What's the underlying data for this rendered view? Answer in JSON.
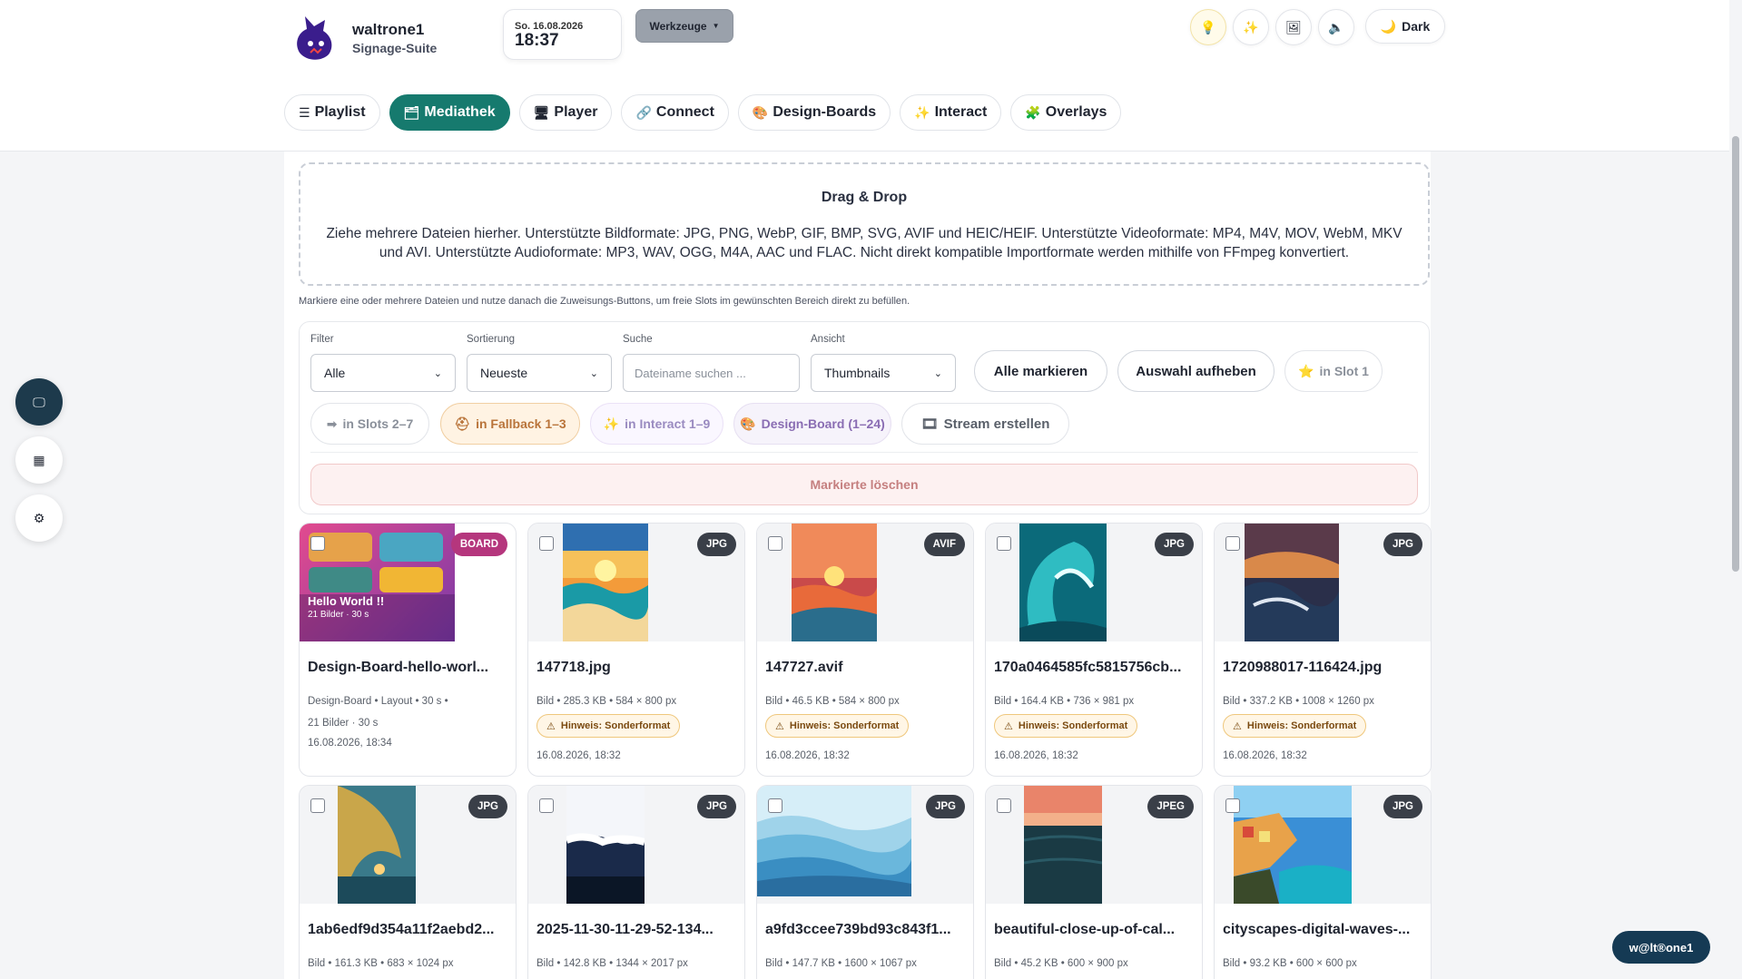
{
  "brand": {
    "name": "waltrone1",
    "subtitle": "Signage-Suite"
  },
  "clock": {
    "date": "So. 16.08.2026",
    "time": "18:37"
  },
  "toolbar": {
    "tools_label": "Werkzeuge",
    "dark_label": "Dark"
  },
  "tabs": [
    {
      "label": "Playlist",
      "icon": "☰"
    },
    {
      "label": "Mediathek",
      "icon": "🗂"
    },
    {
      "label": "Player",
      "icon": "🖥"
    },
    {
      "label": "Connect",
      "icon": "🔗"
    },
    {
      "label": "Design-Boards",
      "icon": "🎨"
    },
    {
      "label": "Interact",
      "icon": "✨"
    },
    {
      "label": "Overlays",
      "icon": "🧩"
    }
  ],
  "dropzone": {
    "title": "Drag & Drop",
    "text": "Ziehe mehrere Dateien hierher. Unterstützte Bildformate: JPG, PNG, WebP, GIF, BMP, SVG, AVIF und HEIC/HEIF. Unterstützte Videoformate: MP4, M4V, MOV, WebM, MKV und AVI. Unterstützte Audioformate: MP3, WAV, OGG, M4A, AAC und FLAC. Nicht direkt kompatible Importformate werden mithilfe von FFmpeg konvertiert."
  },
  "hint": "Markiere eine oder mehrere Dateien und nutze danach die Zuweisungs-Buttons, um freie Slots im gewünschten Bereich direkt zu befüllen.",
  "controls": {
    "filter_label": "Filter",
    "filter_value": "Alle",
    "sort_label": "Sortierung",
    "sort_value": "Neueste",
    "search_label": "Suche",
    "search_placeholder": "Dateiname suchen ...",
    "view_label": "Ansicht",
    "view_value": "Thumbnails",
    "select_all": "Alle markieren",
    "deselect": "Auswahl aufheben",
    "slot1": "in Slot 1",
    "slots27": "in Slots 2–7",
    "fallback": "in Fallback 1–3",
    "interact": "in Interact 1–9",
    "design": "Design-Board (1–24)",
    "stream": "Stream erstellen",
    "delete": "Markierte löschen"
  },
  "cards": [
    {
      "name": "Design-Board-hello-worl...",
      "badge": "BOARD",
      "meta1": "Design-Board  •  Layout  •  30 s  •",
      "meta2": "21 Bilder · 30 s",
      "date": "16.08.2026, 18:34",
      "board_title": "Hello World !!",
      "board_sub": "21 Bilder · 30 s"
    },
    {
      "name": "147718.jpg",
      "badge": "JPG",
      "meta1": "Bild  •  285.3 KB  •  584 × 800 px",
      "warn": "Hinweis: Sonderformat",
      "date": "16.08.2026, 18:32"
    },
    {
      "name": "147727.avif",
      "badge": "AVIF",
      "meta1": "Bild  •  46.5 KB  •  584 × 800 px",
      "warn": "Hinweis: Sonderformat",
      "date": "16.08.2026, 18:32"
    },
    {
      "name": "170a0464585fc5815756cb...",
      "badge": "JPG",
      "meta1": "Bild  •  164.4 KB  •  736 × 981 px",
      "warn": "Hinweis: Sonderformat",
      "date": "16.08.2026, 18:32"
    },
    {
      "name": "1720988017-116424.jpg",
      "badge": "JPG",
      "meta1": "Bild  •  337.2 KB  •  1008 × 1260 px",
      "warn": "Hinweis: Sonderformat",
      "date": "16.08.2026, 18:32"
    },
    {
      "name": "1ab6edf9d354a11f2aebd2...",
      "badge": "JPG",
      "meta1": "Bild  •  161.3 KB  •  683 × 1024 px"
    },
    {
      "name": "2025-11-30-11-29-52-134...",
      "badge": "JPG",
      "meta1": "Bild  •  142.8 KB  •  1344 × 2017 px"
    },
    {
      "name": "a9fd3ccee739bd93c843f1...",
      "badge": "JPG",
      "meta1": "Bild  •  147.7 KB  •  1600 × 1067 px"
    },
    {
      "name": "beautiful-close-up-of-cal...",
      "badge": "JPEG",
      "meta1": "Bild  •  45.2 KB  •  600 × 900 px"
    },
    {
      "name": "cityscapes-digital-waves-...",
      "badge": "JPG",
      "meta1": "Bild  •  93.2 KB  •  600 × 600 px"
    }
  ],
  "user_badge": "w@lt®one1",
  "colors": {
    "accent": "#167a6e",
    "board": "#b5367d",
    "badge": "#3a3f48",
    "warn_border": "#efc77c"
  }
}
